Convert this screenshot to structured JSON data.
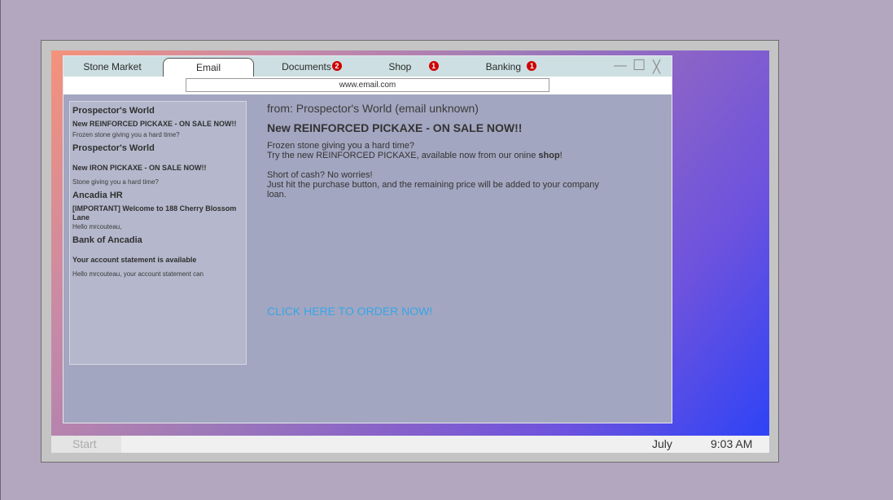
{
  "browser": {
    "tabs": [
      {
        "label": "Stone Market",
        "badge": ""
      },
      {
        "label": "Email",
        "badge": ""
      },
      {
        "label": "Documents",
        "badge": "2"
      },
      {
        "label": "Shop",
        "badge": "1"
      },
      {
        "label": "Banking",
        "badge": "1"
      }
    ],
    "active_tab": "Email",
    "window_controls": {
      "minimize": "—",
      "maximize": "☐",
      "close": "╳"
    },
    "url": "www.email.com"
  },
  "inbox": [
    {
      "sender": "Prospector's World",
      "subject": "New REINFORCED PICKAXE - ON SALE NOW!!",
      "preview": "Frozen stone giving you a hard time?"
    },
    {
      "sender": "Prospector's World",
      "subject": "New IRON PICKAXE - ON SALE NOW!!",
      "preview": "Stone giving you a hard time?"
    },
    {
      "sender": "Ancadia HR",
      "subject": "[IMPORTANT] Welcome to 188 Cherry Blossom Lane",
      "preview": "Hello mrcouteau,"
    },
    {
      "sender": "Bank of Ancadia",
      "subject": "Your account statement is available",
      "preview": "Hello mrcouteau, your account statement can"
    }
  ],
  "message": {
    "from": "from: Prospector's World (email unknown)",
    "subject": "New REINFORCED PICKAXE - ON SALE NOW!!",
    "line1": "Frozen stone giving you a hard time?",
    "line2": "Try the new REINFORCED PICKAXE, available now from our onine ",
    "line2_bold": "shop",
    "line2_end": "!",
    "line3": "Short of cash? No worries!",
    "line4": "Just hit the purchase button, and the remaining price will be added to your company loan.",
    "link": "CLICK HERE TO ORDER NOW!"
  },
  "taskbar": {
    "start": "Start",
    "month": "July",
    "time": "9:03 AM"
  },
  "colors": {
    "badge": "#cc0000",
    "link": "#35a5e8",
    "tabbar": "#cddfe2",
    "window_bg": "#a3a6c0"
  }
}
